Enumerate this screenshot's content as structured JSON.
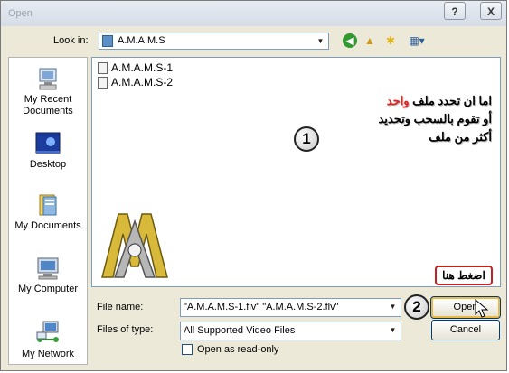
{
  "window": {
    "title": "Open"
  },
  "titlebar": {
    "help_label": "?",
    "close_label": "X"
  },
  "lookin": {
    "label": "Look in:",
    "value": "A.M.A.M.S"
  },
  "toolbar": {
    "icons": [
      "back-icon",
      "up-folder-icon",
      "new-folder-icon",
      "views-menu-icon"
    ]
  },
  "places": [
    {
      "label": "My Recent Documents",
      "icon": "recent-documents-icon"
    },
    {
      "label": "Desktop",
      "icon": "desktop-icon"
    },
    {
      "label": "My Documents",
      "icon": "my-documents-icon"
    },
    {
      "label": "My Computer",
      "icon": "my-computer-icon"
    },
    {
      "label": "My Network",
      "icon": "my-network-icon"
    }
  ],
  "files": [
    {
      "name": "A.M.A.M.S-1"
    },
    {
      "name": "A.M.A.M.S-2"
    }
  ],
  "annotation": {
    "line1_a": "اما ان تحدد ملف ",
    "line1_b": "واحد",
    "line2": "أو تقوم بالسحب وتحديد",
    "line3": "أكثر من ملف",
    "badge1": "1",
    "badge2": "2",
    "callout": "اضغط هنا"
  },
  "form": {
    "file_name_label": "File name:",
    "file_name_value": "\"A.M.A.M.S-1.flv\" \"A.M.A.M.S-2.flv\"",
    "file_type_label": "Files of type:",
    "file_type_value": "All Supported Video Files",
    "readonly_label": "Open as read-only",
    "open_label": "Open",
    "cancel_label": "Cancel"
  },
  "colors": {
    "accent_red": "#e0201c",
    "dialog_bg": "#ece9d8",
    "border_blue": "#7f9db9"
  }
}
